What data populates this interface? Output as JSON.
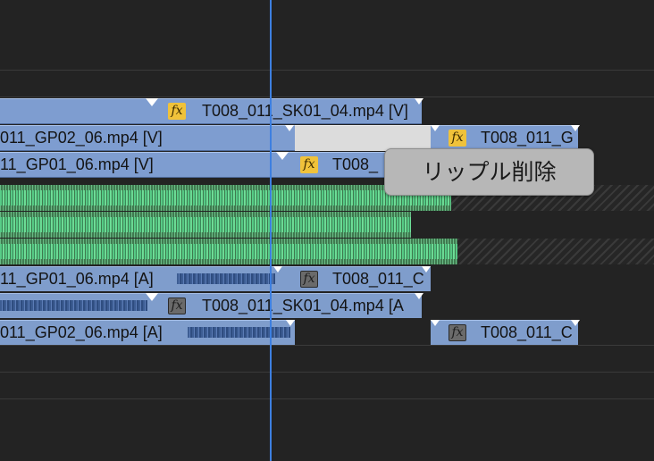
{
  "timeline": {
    "video_tracks": {
      "v3": {
        "clip_a_label": "",
        "clip_b_label": "T008_011_SK01_04.mp4 [V]"
      },
      "v2": {
        "clip_a_label": "011_GP02_06.mp4 [V]",
        "clip_c_label": "T008_011_G"
      },
      "v1": {
        "clip_a_label": "11_GP01_06.mp4 [V]",
        "clip_b_label": "T008_"
      }
    },
    "audio_tracks": {
      "a4": {
        "clip_a_label": "11_GP01_06.mp4 [A]",
        "clip_b_label": "T008_011_C"
      },
      "a5": {
        "clip_b_label": "T008_011_SK01_04.mp4 [A"
      },
      "a6": {
        "clip_a_label": "011_GP02_06.mp4 [A]",
        "clip_b_label": "T008_011_C"
      }
    },
    "fx_badge": "fx"
  },
  "tooltip": {
    "label": "リップル削除"
  },
  "colors": {
    "video_clip": "#7e9dd0",
    "audio_waveform": "#56cf88",
    "selected_gap": "#dcdcdc",
    "playhead": "#3d7fe0",
    "fx_badge": "#f0c23a"
  }
}
